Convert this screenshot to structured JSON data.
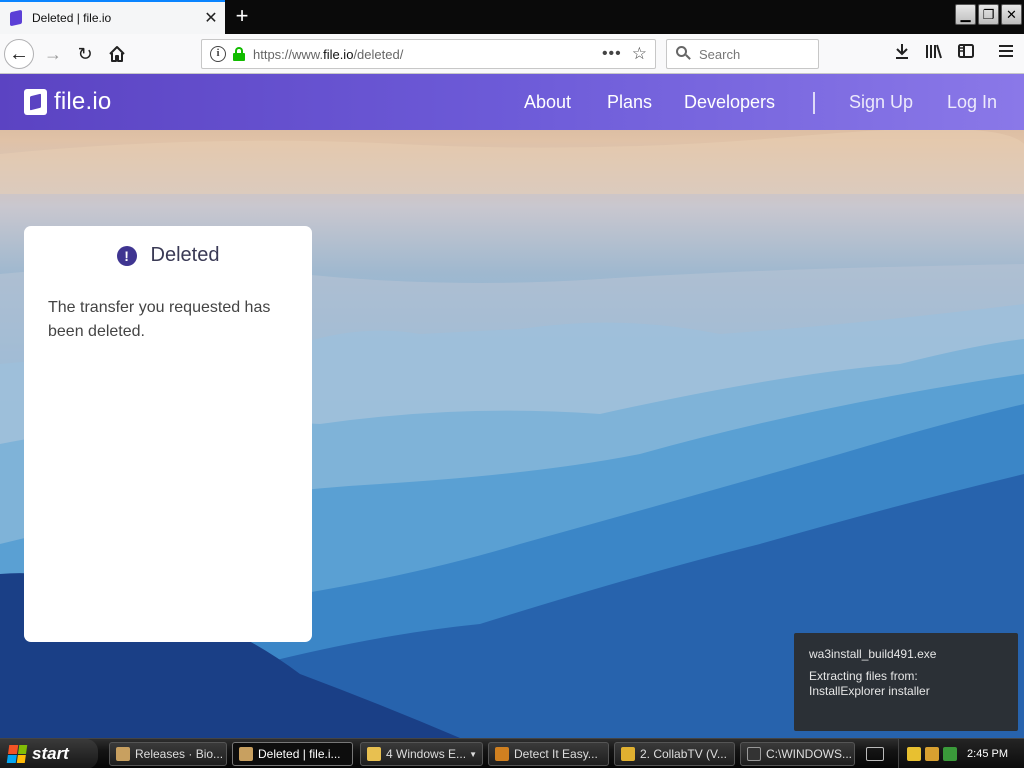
{
  "browser": {
    "tab_title": "Deleted | file.io",
    "tab_close": "✕",
    "new_tab": "+",
    "url_prefix": "https://www.",
    "url_domain": "file.io",
    "url_path": "/deleted/",
    "search_placeholder": "Search",
    "window_controls": {
      "minimize": "▁",
      "restore": "❐",
      "close": "✕"
    }
  },
  "site": {
    "logo_text": "file.io",
    "brand_color": "#5b43c2",
    "nav": {
      "about": "About",
      "plans": "Plans",
      "developers": "Developers",
      "sign_up": "Sign Up",
      "log_in": "Log In"
    }
  },
  "card": {
    "title": "Deleted",
    "icon": "alert-icon",
    "message": "The transfer you requested has been deleted."
  },
  "toast": {
    "title": "wa3install_build491.exe",
    "line1": "Extracting files from:",
    "line2": "InstallExplorer installer"
  },
  "taskbar": {
    "start_label": "start",
    "tasks": [
      {
        "label": "Releases · Bio...",
        "icon_color": "#c8a060"
      },
      {
        "label": "Deleted | file.i...",
        "icon_color": "#c8a060"
      },
      {
        "label": "4 Windows E...",
        "icon_color": "#e8c050"
      },
      {
        "label": "Detect It Easy...",
        "icon_color": "#d08020"
      },
      {
        "label": "2. CollabTV (V...",
        "icon_color": "#e0b030"
      },
      {
        "label": "C:\\WINDOWS...",
        "icon_color": "#333333"
      }
    ],
    "clock": "2:45 PM"
  }
}
